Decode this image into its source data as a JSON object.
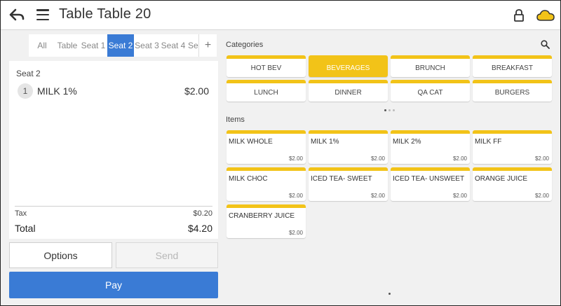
{
  "header": {
    "title": "Table Table 20",
    "back_icon": "back-arrow-icon",
    "menu_icon": "hamburger-menu-icon",
    "lock_icon": "lock-icon",
    "cloud_icon": "cloud-icon",
    "cloud_color": "#f2c318"
  },
  "seat_tabs": [
    {
      "label": "All",
      "active": false
    },
    {
      "label": "Table",
      "active": false
    },
    {
      "label": "Seat 1",
      "active": false
    },
    {
      "label": "Seat 2",
      "active": true
    },
    {
      "label": "Seat 3",
      "active": false
    },
    {
      "label": "Seat 4",
      "active": false
    },
    {
      "label": "Sea",
      "active": false
    }
  ],
  "add_tab_label": "+",
  "order": {
    "seat_label": "Seat 2",
    "lines": [
      {
        "qty": "1",
        "name": "MILK 1%",
        "price": "$2.00"
      }
    ],
    "tax_label": "Tax",
    "tax_value": "$0.20",
    "total_label": "Total",
    "total_value": "$4.20"
  },
  "buttons": {
    "options": "Options",
    "send": "Send",
    "pay": "Pay"
  },
  "colors": {
    "accent_blue": "#3a7bd5",
    "category_yellow": "#f2c318"
  },
  "categories_label": "Categories",
  "categories": [
    {
      "label": "HOT BEV",
      "active": false
    },
    {
      "label": "BEVERAGES",
      "active": true
    },
    {
      "label": "BRUNCH",
      "active": false
    },
    {
      "label": "BREAKFAST",
      "active": false
    },
    {
      "label": "LUNCH",
      "active": false
    },
    {
      "label": "DINNER",
      "active": false
    },
    {
      "label": "QA CAT",
      "active": false
    },
    {
      "label": "BURGERS",
      "active": false
    }
  ],
  "category_pages": {
    "count": 3,
    "current": 1
  },
  "items_label": "Items",
  "items": [
    {
      "name": "MILK WHOLE",
      "price": "$2.00"
    },
    {
      "name": "MILK 1%",
      "price": "$2.00"
    },
    {
      "name": "MILK 2%",
      "price": "$2.00"
    },
    {
      "name": "MILK FF",
      "price": "$2.00"
    },
    {
      "name": "MILK CHOC",
      "price": "$2.00"
    },
    {
      "name": "ICED TEA- SWEET",
      "price": "$2.00"
    },
    {
      "name": "ICED TEA- UNSWEET",
      "price": "$2.00"
    },
    {
      "name": "ORANGE JUICE",
      "price": "$2.00"
    },
    {
      "name": "CRANBERRY JUICE",
      "price": "$2.00"
    }
  ],
  "item_pages": {
    "count": 1,
    "current": 1
  }
}
